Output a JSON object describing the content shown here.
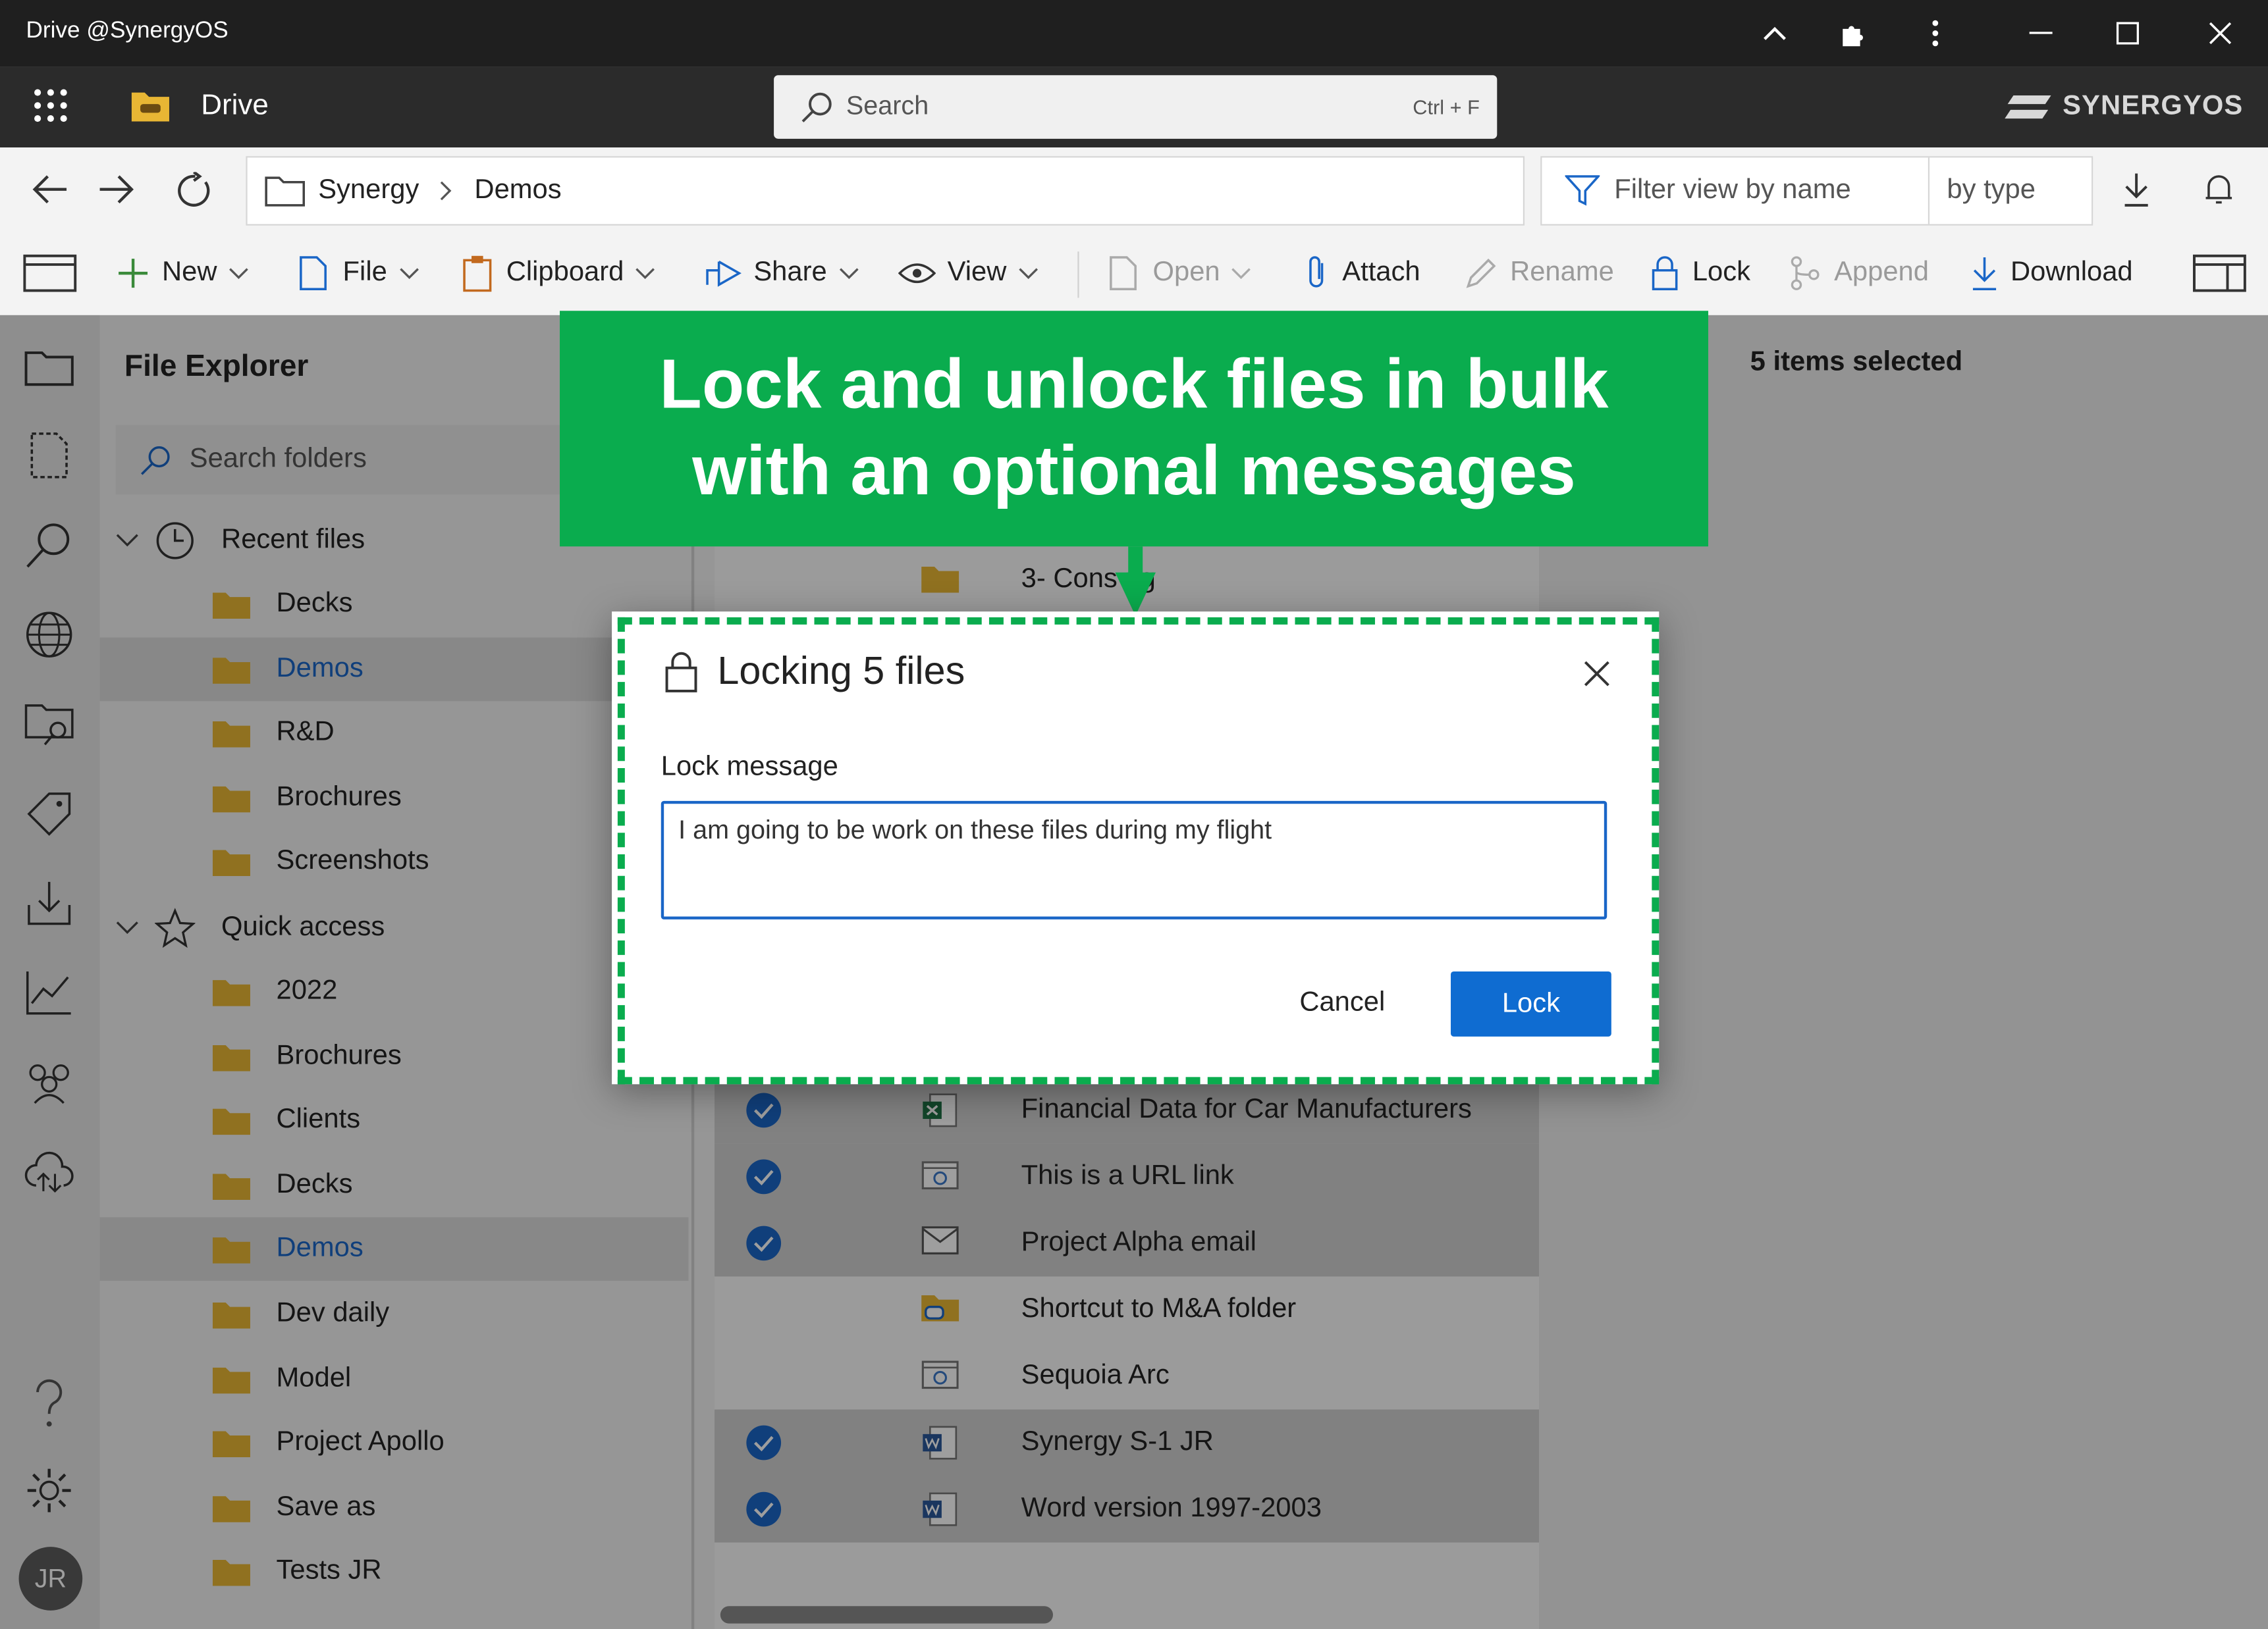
{
  "window": {
    "title": "Drive @SynergyOS"
  },
  "appbar": {
    "app_name": "Drive",
    "brand": "SYNERGYOS"
  },
  "search": {
    "placeholder": "Search",
    "shortcut": "Ctrl + F"
  },
  "address": {
    "breadcrumb": [
      "Synergy",
      "Demos"
    ],
    "filter_placeholder": "Filter view by name",
    "filter_type": "by type"
  },
  "commands": {
    "new": "New",
    "file": "File",
    "clipboard": "Clipboard",
    "share": "Share",
    "view": "View",
    "open": "Open",
    "attach": "Attach",
    "rename": "Rename",
    "lock": "Lock",
    "append": "Append",
    "download": "Download"
  },
  "sidebar": {
    "title": "File Explorer",
    "search_placeholder": "Search folders",
    "recent_label": "Recent files",
    "recent": [
      "Decks",
      "Demos",
      "R&D",
      "Brochures",
      "Screenshots"
    ],
    "quick_label": "Quick access",
    "quick": [
      "2022",
      "Brochures",
      "Clients",
      "Decks",
      "Demos",
      "Dev daily",
      "Model",
      "Project Apollo",
      "Save as",
      "Tests JR"
    ],
    "selected": "Demos",
    "user_initials": "JR"
  },
  "content": {
    "top_partial": "3- Cons   ng",
    "rows": [
      {
        "name": "Financial Data for Car Manufacturers",
        "selected": true,
        "icon": "excel-icon"
      },
      {
        "name": "This is a URL link",
        "selected": true,
        "icon": "link-icon"
      },
      {
        "name": "Project Alpha email",
        "selected": true,
        "icon": "mail-icon"
      },
      {
        "name": "Shortcut to M&A folder",
        "selected": false,
        "icon": "shortcut-folder-icon"
      },
      {
        "name": "Sequoia Arc",
        "selected": false,
        "icon": "link-icon"
      },
      {
        "name": "Synergy S-1 JR",
        "selected": true,
        "icon": "word-icon"
      },
      {
        "name": "Word version 1997-2003",
        "selected": true,
        "icon": "word-icon"
      }
    ]
  },
  "details": {
    "selection": "5 items selected"
  },
  "banner": {
    "line1": "Lock and unlock files in bulk",
    "line2": "with an optional messages"
  },
  "dialog": {
    "title": "Locking 5 files",
    "label": "Lock message",
    "message": "I am going to be work on these files during my flight",
    "cancel": "Cancel",
    "confirm": "Lock"
  },
  "colors": {
    "accent": "#0f6cd1",
    "highlight": "#0aac4e"
  }
}
